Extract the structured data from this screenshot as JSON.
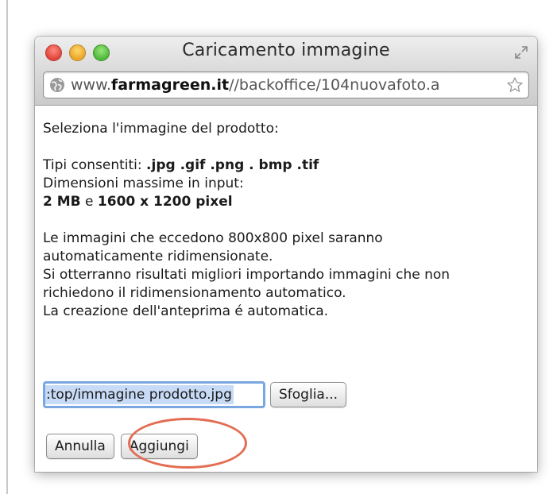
{
  "window": {
    "title": "Caricamento immagine",
    "url": {
      "prefix": "www.",
      "domain": "farmagreen.it",
      "path": "//backoffice/104nuovafoto.a"
    }
  },
  "content": {
    "intro": "Seleziona l'immagine del prodotto:",
    "allowed_label": "Tipi consentiti: ",
    "allowed_types": ".jpg .gif .png . bmp .tif",
    "max_dim_label": "Dimensioni massime in input:",
    "max_size": "2 MB",
    "conj": " e ",
    "max_pixels": "1600 x 1200 pixel",
    "resize_note_1": "Le immagini che eccedono 800x800 pixel saranno",
    "resize_note_2": "automaticamente ridimensionate.",
    "resize_note_3": "Si otterranno risultati migliori importando immagini che non",
    "resize_note_4": "richiedono il ridimensionamento automatico.",
    "preview_note": "La creazione dell'anteprima é automatica."
  },
  "file_picker": {
    "value": ":top/immagine prodotto.jpg",
    "browse_label": "Sfoglia..."
  },
  "actions": {
    "cancel_label": "Annulla",
    "add_label": "Aggiungi"
  },
  "colors": {
    "highlight_ring": "#e36d52",
    "file_focus": "#7aa7e0"
  }
}
